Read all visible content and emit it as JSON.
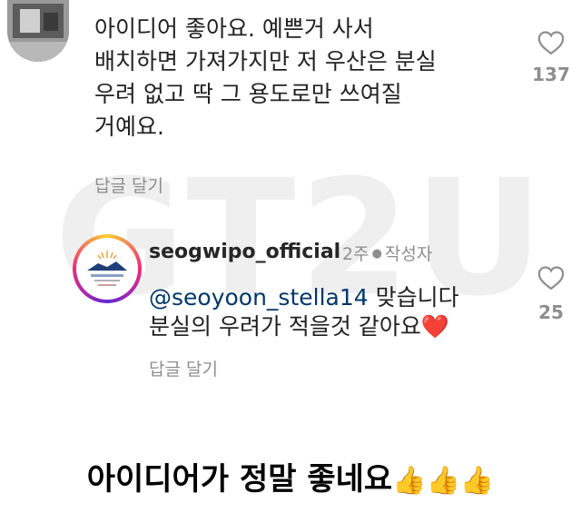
{
  "watermark": "GT2U",
  "comment_top": {
    "text": "아이디어 좋아요. 예쁜거 사서\n배치하면 가져가지만 저 우산은 분실\n우려 없고 딱 그 용도로만 쓰여질\n거예요.",
    "reply_label": "답글 달기",
    "like_count": "137"
  },
  "reply": {
    "username": "seogwipo_official",
    "time": "2주",
    "author_badge": "작성자",
    "mention": "@seoyoon_stella14",
    "text_after_mention": " 맞습니다",
    "text_line2": "분실의 우려가 적을것 같아요",
    "emoji": "❤️",
    "reply_label": "답글 달기",
    "like_count": "25"
  },
  "caption": {
    "text": "아이디어가 정말 좋네요",
    "emoji": "👍👍👍"
  },
  "icons": {
    "heart": "heart-outline-icon"
  },
  "colors": {
    "mention": "#00376b",
    "muted": "#8e8e8e",
    "heart_emoji": "#e0245e"
  }
}
